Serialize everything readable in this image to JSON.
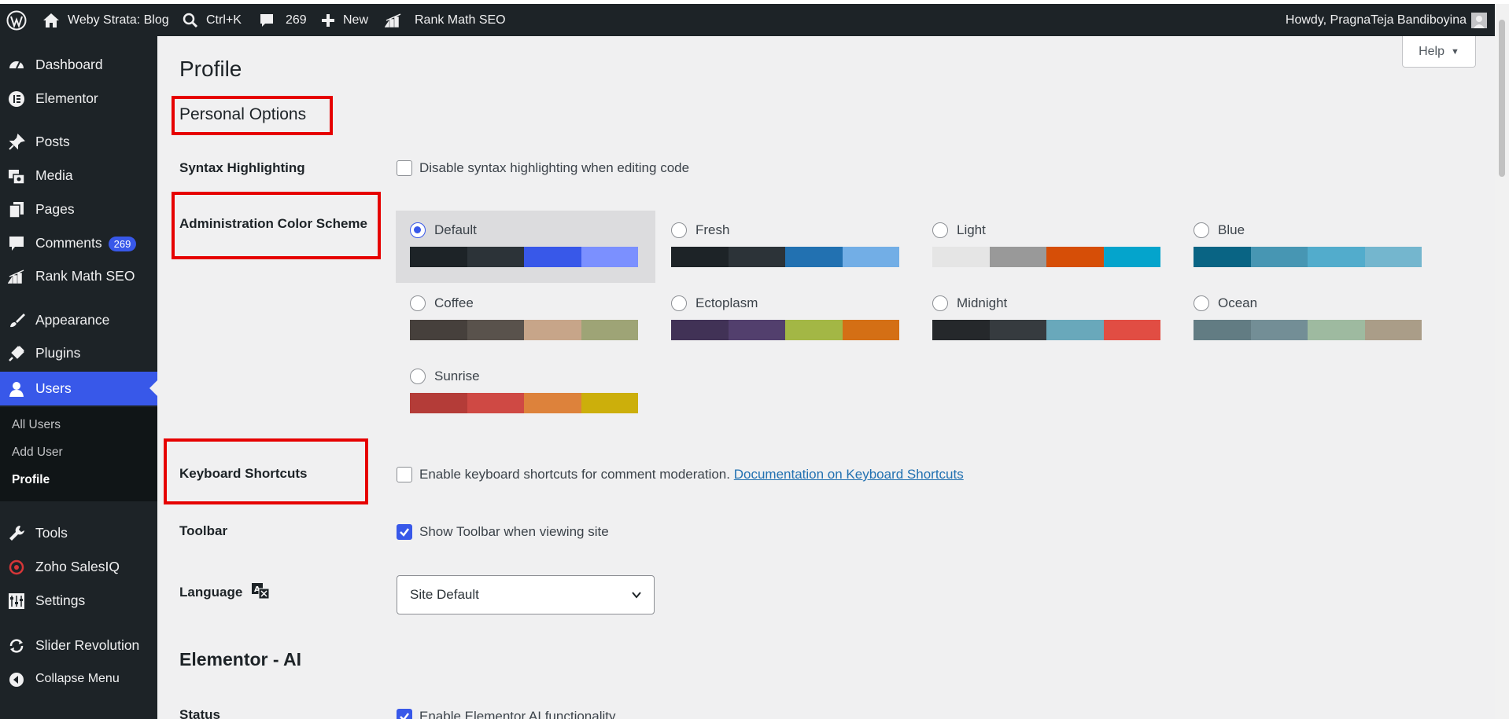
{
  "adminbar": {
    "site_name": "Weby Strata: Blog",
    "search_shortcut": "Ctrl+K",
    "comments_count": "269",
    "new_label": "New",
    "seo_label": "Rank Math SEO",
    "howdy": "Howdy, PragnaTeja Bandiboyina"
  },
  "sidebar": {
    "items": [
      {
        "label": "Dashboard",
        "icon": "dashboard-icon"
      },
      {
        "label": "Elementor",
        "icon": "elementor-icon"
      },
      {
        "label": "Posts",
        "icon": "pin-icon"
      },
      {
        "label": "Media",
        "icon": "media-icon"
      },
      {
        "label": "Pages",
        "icon": "pages-icon"
      },
      {
        "label": "Comments",
        "icon": "comments-icon",
        "badge": "269"
      },
      {
        "label": "Rank Math SEO",
        "icon": "rank-math-icon"
      },
      {
        "label": "Appearance",
        "icon": "brush-icon"
      },
      {
        "label": "Plugins",
        "icon": "plugin-icon"
      },
      {
        "label": "Users",
        "icon": "users-icon"
      },
      {
        "label": "Tools",
        "icon": "wrench-icon"
      },
      {
        "label": "Zoho SalesIQ",
        "icon": "salesiq-icon"
      },
      {
        "label": "Settings",
        "icon": "settings-icon"
      },
      {
        "label": "Slider Revolution",
        "icon": "refresh-icon"
      },
      {
        "label": "Collapse Menu",
        "icon": "collapse-icon"
      }
    ],
    "submenu": [
      "All Users",
      "Add User",
      "Profile"
    ]
  },
  "content": {
    "help_label": "Help",
    "page_title": "Profile",
    "personal_options_heading": "Personal Options",
    "syntax_label": "Syntax Highlighting",
    "syntax_checkbox_text": "Disable syntax highlighting when editing code",
    "color_scheme_label": "Administration Color Scheme",
    "schemes": [
      {
        "name": "Default",
        "colors": [
          "#1d2327",
          "#2c3338",
          "#3858e9",
          "#7b90ff"
        ],
        "selected": true
      },
      {
        "name": "Fresh",
        "colors": [
          "#1d2327",
          "#2c3338",
          "#2271b1",
          "#72aee6"
        ]
      },
      {
        "name": "Light",
        "colors": [
          "#e5e5e5",
          "#999999",
          "#d64e07",
          "#04a4cc"
        ]
      },
      {
        "name": "Blue",
        "colors": [
          "#096484",
          "#4796b3",
          "#52accc",
          "#74b6ce"
        ]
      },
      {
        "name": "Coffee",
        "colors": [
          "#46403c",
          "#59524c",
          "#c7a589",
          "#9ea476"
        ]
      },
      {
        "name": "Ectoplasm",
        "colors": [
          "#413256",
          "#523f6d",
          "#a3b745",
          "#d46f15"
        ]
      },
      {
        "name": "Midnight",
        "colors": [
          "#25282b",
          "#363b3f",
          "#69a8bb",
          "#e14d43"
        ]
      },
      {
        "name": "Ocean",
        "colors": [
          "#627c83",
          "#738e96",
          "#9ebaa0",
          "#aa9d88"
        ]
      },
      {
        "name": "Sunrise",
        "colors": [
          "#b43c38",
          "#cf4944",
          "#dd823b",
          "#ccaf0b"
        ]
      }
    ],
    "keyboard_label": "Keyboard Shortcuts",
    "keyboard_text": "Enable keyboard shortcuts for comment moderation.",
    "keyboard_link": "Documentation on Keyboard Shortcuts",
    "toolbar_label": "Toolbar",
    "toolbar_text": "Show Toolbar when viewing site",
    "language_label": "Language",
    "language_value": "Site Default",
    "elementor_heading": "Elementor - AI",
    "status_label": "Status",
    "status_text": "Enable Elementor AI functionality"
  },
  "colors": {
    "accent": "#3858e9",
    "sidebar_bg": "#1d2327",
    "annotation_red": "#e60000"
  }
}
